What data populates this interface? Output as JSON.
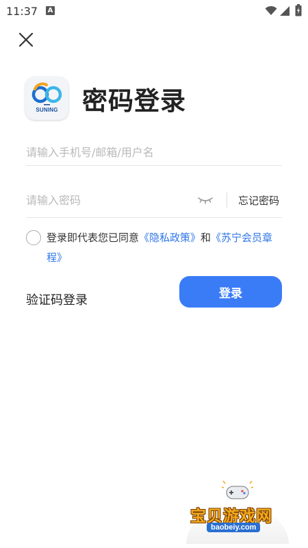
{
  "status_bar": {
    "time": "11:37",
    "notification_icon": "A",
    "icons": [
      "wifi-icon",
      "signal-icon",
      "battery-icon"
    ]
  },
  "header": {
    "close_icon": "close-icon"
  },
  "brand": {
    "logo_text": "SUNING",
    "colors": {
      "blue": "#1a6fd0",
      "gold": "#f2a21d",
      "cyan": "#3cb6e8"
    }
  },
  "page": {
    "title": "密码登录"
  },
  "form": {
    "account_placeholder": "请输入手机号/邮箱/用户名",
    "password_placeholder": "请输入密码",
    "eye_icon": "eye-closed-icon",
    "forgot_password": "忘记密码"
  },
  "agreement": {
    "prefix": "登录即代表您已同意",
    "privacy_link": "《隐私政策》",
    "conjunction": "和",
    "member_link": "《苏宁会员章程》"
  },
  "actions": {
    "sms_login": "验证码登录",
    "login_button": "登录",
    "accent_color": "#3a7cf6"
  },
  "watermark": {
    "title": "宝贝游戏网",
    "url": "baobeiy.com"
  }
}
